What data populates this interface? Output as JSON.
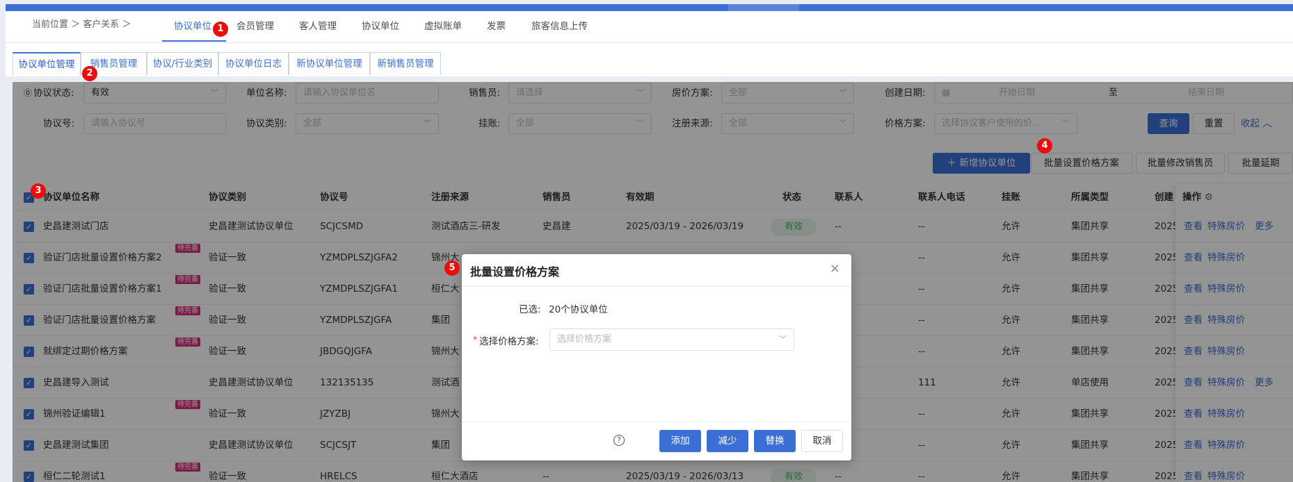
{
  "nav": {
    "breadcrumb": "当前位置 ＞ 客户关系 ＞",
    "tabs": [
      "协议单位",
      "会员管理",
      "客人管理",
      "协议单位",
      "虚拟账单",
      "发票",
      "旅客信息上传"
    ]
  },
  "subtabs": [
    "协议单位管理",
    "销售员管理",
    "协议/行业类别",
    "协议单位日志",
    "新协议单位管理",
    "新销售员管理"
  ],
  "markers": [
    "1",
    "2",
    "3",
    "4",
    "5"
  ],
  "filters": {
    "status_label": "协议状态:",
    "status_value": "有效",
    "unit_name_label": "单位名称:",
    "unit_name_placeholder": "请输入协议单位名",
    "salesperson_label": "销售员:",
    "salesperson_placeholder": "请选择",
    "room_price_label": "房价方案:",
    "room_price_value": "全部",
    "created_date_label": "创建日期:",
    "start_date_placeholder": "开始日期",
    "date_to": "至",
    "end_date_placeholder": "结束日期",
    "agreement_no_label": "协议号:",
    "agreement_no_placeholder": "请输入协议号",
    "agreement_type_label": "协议类别:",
    "agreement_type_value": "全部",
    "credit_label": "挂账:",
    "credit_value": "全部",
    "source_label": "注册来源:",
    "source_value": "全部",
    "price_plan_label": "价格方案:",
    "price_plan_placeholder": "选择协议客户使用的价...",
    "query_button": "查询",
    "reset_button": "重置",
    "collapse_link": "收起"
  },
  "actions": {
    "add_button": "新增协议单位",
    "batch_price_button": "批量设置价格方案",
    "batch_sales_button": "批量修改销售员",
    "batch_extend_button": "批量延期"
  },
  "table": {
    "columns": [
      "协议单位名称",
      "协议类别",
      "协议号",
      "注册来源",
      "销售员",
      "有效期",
      "状态",
      "联系人",
      "联系人电话",
      "挂账",
      "所属类型",
      "创建",
      "操作"
    ],
    "rows": [
      {
        "name": "史昌建测试门店",
        "tag": "",
        "type": "史昌建测试协议单位",
        "no": "SCJCSMD",
        "source": "测试酒店三-研发",
        "sales": "史昌建",
        "period": "2025/03/19 - 2026/03/19",
        "status": "有效",
        "contact": "--",
        "phone": "--",
        "credit": "允许",
        "belong": "集团共享",
        "created": "2025",
        "ops": [
          "查看",
          "特殊房价",
          "更多"
        ]
      },
      {
        "name": "验证门店批量设置价格方案2",
        "tag": "待完善",
        "type": "验证一致",
        "no": "YZMDPLSZJGFA2",
        "source": "锦州大",
        "sales": "",
        "period": "",
        "status": "",
        "contact": "",
        "phone": "--",
        "credit": "允许",
        "belong": "集团共享",
        "created": "2025",
        "ops": [
          "查看",
          "特殊房价"
        ]
      },
      {
        "name": "验证门店批量设置价格方案1",
        "tag": "待完善",
        "type": "验证一致",
        "no": "YZMDPLSZJGFA1",
        "source": "桓仁大",
        "sales": "",
        "period": "",
        "status": "",
        "contact": "",
        "phone": "--",
        "credit": "允许",
        "belong": "集团共享",
        "created": "2025",
        "ops": [
          "查看",
          "特殊房价"
        ]
      },
      {
        "name": "验证门店批量设置价格方案",
        "tag": "待完善",
        "type": "验证一致",
        "no": "YZMDPLSZJGFA",
        "source": "集团",
        "sales": "",
        "period": "",
        "status": "",
        "contact": "",
        "phone": "--",
        "credit": "允许",
        "belong": "集团共享",
        "created": "2025",
        "ops": [
          "查看",
          "特殊房价"
        ]
      },
      {
        "name": "就绑定过期价格方案",
        "tag": "待完善",
        "type": "验证一致",
        "no": "JBDGQJGFA",
        "source": "锦州大",
        "sales": "",
        "period": "",
        "status": "",
        "contact": "",
        "phone": "--",
        "credit": "允许",
        "belong": "集团共享",
        "created": "2025",
        "ops": [
          "查看",
          "特殊房价"
        ]
      },
      {
        "name": "史昌建导入测试",
        "tag": "",
        "type": "史昌建测试协议单位",
        "no": "132135135",
        "source": "测试酒",
        "sales": "",
        "period": "",
        "status": "",
        "contact": "",
        "phone": "111",
        "credit": "允许",
        "belong": "单店使用",
        "created": "2025",
        "ops": [
          "查看",
          "特殊房价",
          "更多"
        ]
      },
      {
        "name": "锦州验证编辑1",
        "tag": "待完善",
        "type": "验证一致",
        "no": "JZYZBJ",
        "source": "锦州大",
        "sales": "",
        "period": "",
        "status": "",
        "contact": "",
        "phone": "--",
        "credit": "允许",
        "belong": "集团共享",
        "created": "2025",
        "ops": [
          "查看",
          "特殊房价"
        ]
      },
      {
        "name": "史昌建测试集团",
        "tag": "",
        "type": "史昌建测试协议单位",
        "no": "SCJCSJT",
        "source": "集团",
        "sales": "",
        "period": "",
        "status": "",
        "contact": "",
        "phone": "--",
        "credit": "允许",
        "belong": "集团共享",
        "created": "2025",
        "ops": [
          "查看",
          "特殊房价"
        ]
      },
      {
        "name": "桓仁二轮测试1",
        "tag": "待完善",
        "type": "验证一致",
        "no": "HRELCS",
        "source": "桓仁大酒店",
        "sales": "--",
        "period": "2025/03/19 - 2026/03/13",
        "status": "有效",
        "contact": "--",
        "phone": "--",
        "credit": "允许",
        "belong": "集团共享",
        "created": "2025",
        "ops": [
          "查看",
          "特殊房价"
        ]
      }
    ]
  },
  "modal": {
    "title": "批量设置价格方案",
    "selected_label": "已选:",
    "selected_value": "20个协议单位",
    "required_mark": "*",
    "plan_label": "选择价格方案:",
    "plan_placeholder": "选择价格方案",
    "help_icon": "?",
    "add_button": "添加",
    "reduce_button": "减少",
    "replace_button": "替换",
    "cancel_button": "取消",
    "close_icon": "×"
  },
  "colors": {
    "primary": "#3c6fd6",
    "badge": "#ee0b0b",
    "tag": "#d6307a",
    "status_green": "#53b06a"
  }
}
